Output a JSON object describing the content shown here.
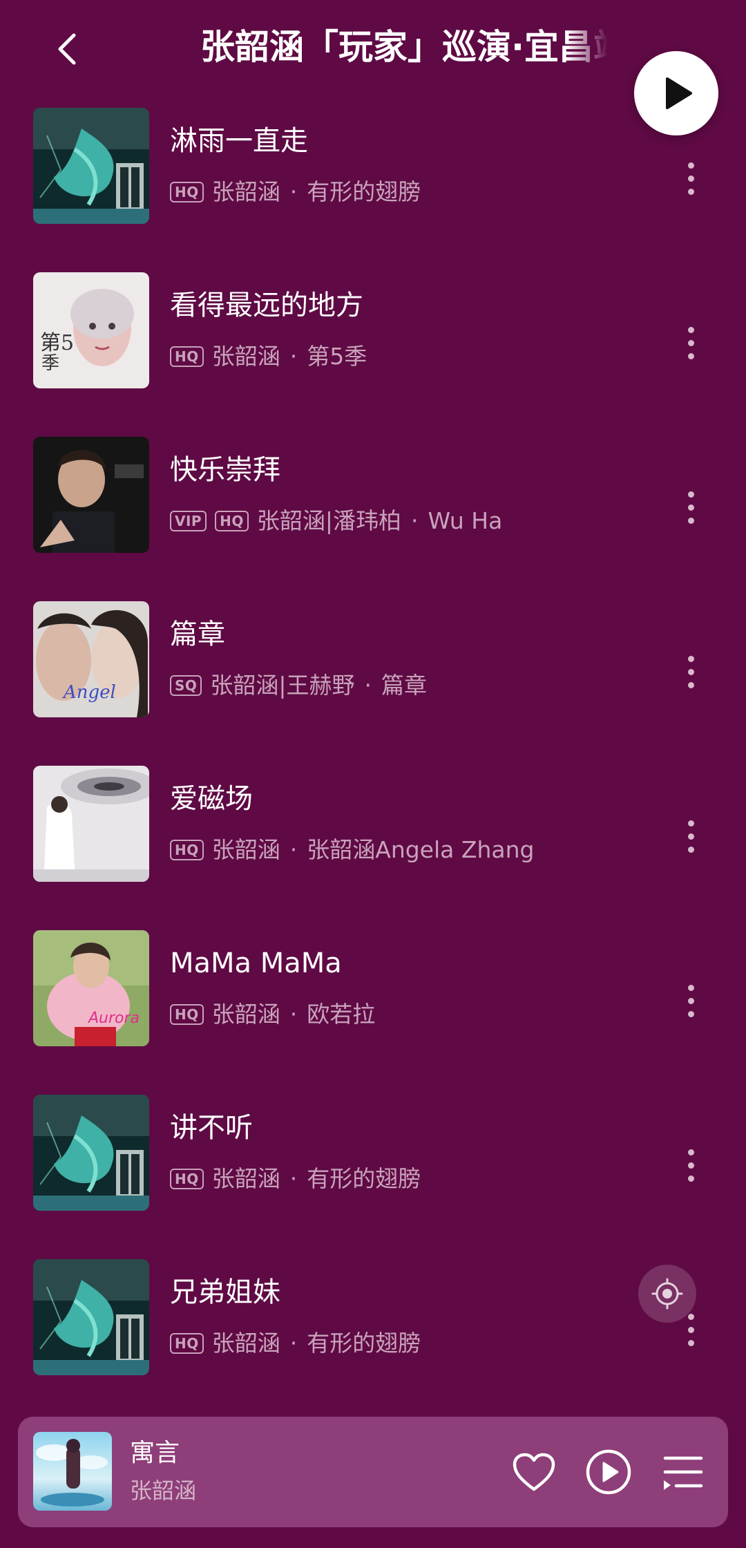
{
  "header": {
    "title": "张韶涵「玩家」巡演·宜昌站",
    "back_icon": "chevron-left-icon",
    "play_all_icon": "play-icon"
  },
  "songs": [
    {
      "title": "淋雨一直走",
      "badges": [
        "HQ"
      ],
      "artist": "张韶涵",
      "album": "有形的翅膀"
    },
    {
      "title": "看得最远的地方",
      "badges": [
        "HQ"
      ],
      "artist": "张韶涵",
      "album": "第5季"
    },
    {
      "title": "快乐崇拜",
      "badges": [
        "VIP",
        "HQ"
      ],
      "artist": "张韶涵|潘玮柏",
      "album": "Wu Ha"
    },
    {
      "title": "篇章",
      "badges": [
        "SQ"
      ],
      "artist": "张韶涵|王赫野",
      "album": "篇章"
    },
    {
      "title": "爱磁场",
      "badges": [
        "HQ"
      ],
      "artist": "张韶涵",
      "album": "张韶涵Angela Zhang"
    },
    {
      "title": "MaMa MaMa",
      "badges": [
        "HQ"
      ],
      "artist": "张韶涵",
      "album": "欧若拉"
    },
    {
      "title": "讲不听",
      "badges": [
        "HQ"
      ],
      "artist": "张韶涵",
      "album": "有形的翅膀"
    },
    {
      "title": "兄弟姐妹",
      "badges": [
        "HQ"
      ],
      "artist": "张韶涵",
      "album": "有形的翅膀"
    }
  ],
  "separator": "·",
  "mini_player": {
    "title": "寓言",
    "artist": "张韶涵"
  },
  "colors": {
    "background": "#5f0a44",
    "mini_player_bg": "#8e3e78",
    "secondary_text": "#c9a2bb"
  }
}
